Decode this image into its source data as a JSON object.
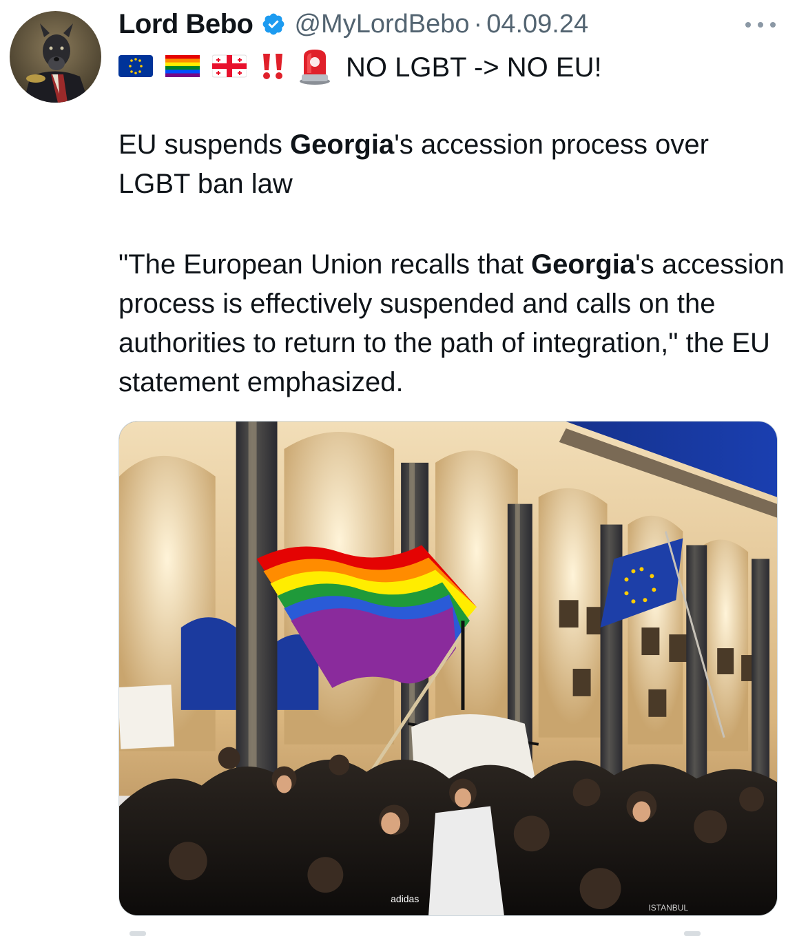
{
  "author": {
    "display_name": "Lord Bebo",
    "handle": "@MyLordBebo",
    "separator": "·",
    "date": "04.09.24",
    "verified": true
  },
  "headline": {
    "emojis": [
      "eu-flag-emoji",
      "rainbow-flag-emoji",
      "georgia-flag-emoji",
      "double-exclamation-emoji",
      "police-light-emoji"
    ],
    "text": "NO LGBT -> NO EU!"
  },
  "body": {
    "p1_pre": "EU suspends ",
    "p1_bold": "Georgia",
    "p1_post": "'s accession process over LGBT ban law",
    "p2_pre": "\"The European Union recalls that ",
    "p2_bold": "Georgia",
    "p2_post": "'s accession process is effectively suspended and calls on the authorities to return to the path of integration,\" the EU statement emphasized."
  },
  "colors": {
    "text": "#0f1419",
    "muted": "#536471",
    "verified_blue": "#1d9bf0"
  },
  "media": {
    "image_text": [
      "adidas",
      "ISTANBUL"
    ]
  }
}
